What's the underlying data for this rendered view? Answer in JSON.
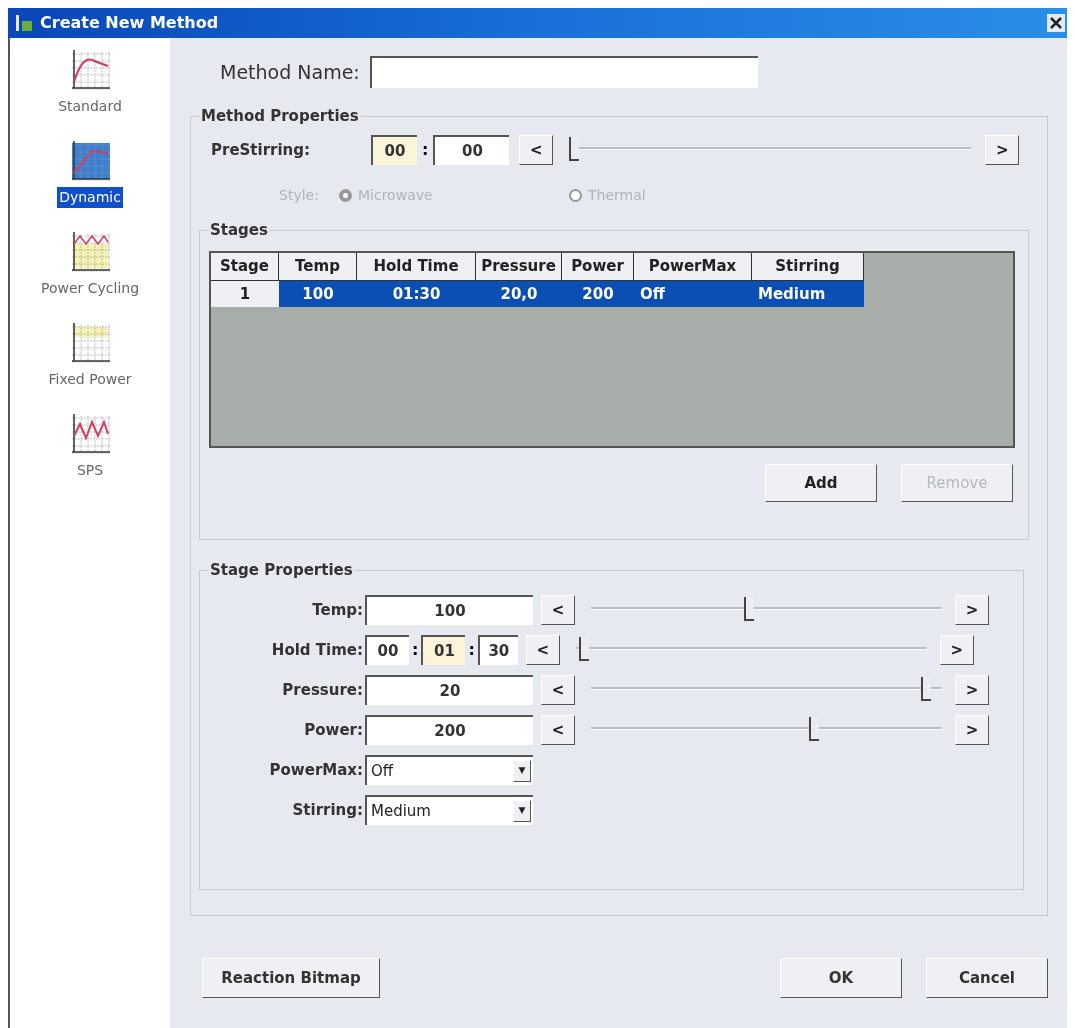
{
  "window": {
    "title": "Create New Method"
  },
  "sidebar": {
    "items": [
      {
        "label": "Standard",
        "selected": false
      },
      {
        "label": "Dynamic",
        "selected": true
      },
      {
        "label": "Power Cycling",
        "selected": false
      },
      {
        "label": "Fixed Power",
        "selected": false
      },
      {
        "label": "SPS",
        "selected": false
      }
    ]
  },
  "method_name": {
    "label": "Method Name:"
  },
  "method_properties": {
    "title": "Method Properties",
    "prestirring": {
      "label": "PreStirring:",
      "fields": [
        {
          "value": "00",
          "focused": true
        },
        {
          "value": "00",
          "focused": false
        }
      ],
      "separator": ":",
      "decrement": "<",
      "increment": ">",
      "level": 0.0
    },
    "style": {
      "label": "Style:",
      "disabled": true,
      "options": [
        {
          "label": "Microwave",
          "selected": true
        },
        {
          "label": "Thermal",
          "selected": false
        }
      ]
    }
  },
  "stages": {
    "title": "Stages",
    "columns": [
      "Stage",
      "Temp",
      "Hold Time",
      "Pressure",
      "Power",
      "PowerMax",
      "Stirring"
    ],
    "rows": [
      {
        "cells": [
          "1",
          "100",
          "01:30",
          "20,0",
          "200",
          "Off",
          "Medium"
        ],
        "selected": true
      }
    ],
    "buttons": [
      {
        "label": "Add",
        "disabled": false
      },
      {
        "label": "Remove",
        "disabled": true
      }
    ]
  },
  "stage_properties": {
    "title": "Stage Properties",
    "rows": [
      {
        "kind": "slider",
        "label": "Temp:",
        "value": "100",
        "decrement": "<",
        "increment": ">",
        "level": 0.45
      },
      {
        "kind": "time",
        "label": "Hold Time:",
        "fields": [
          {
            "value": "00",
            "focused": false
          },
          {
            "value": "01",
            "focused": true
          },
          {
            "value": "30",
            "focused": false
          }
        ],
        "separator": ":",
        "decrement": "<",
        "increment": ">",
        "level": 0.01
      },
      {
        "kind": "slider",
        "label": "Pressure:",
        "value": "20",
        "decrement": "<",
        "increment": ">",
        "level": 0.97
      },
      {
        "kind": "slider",
        "label": "Power:",
        "value": "200",
        "decrement": "<",
        "increment": ">",
        "level": 0.64
      },
      {
        "kind": "dropdown",
        "label": "PowerMax:",
        "value": "Off",
        "arrow": "▼"
      },
      {
        "kind": "dropdown",
        "label": "Stirring:",
        "value": "Medium",
        "arrow": "▼"
      }
    ]
  },
  "footer": {
    "buttons": [
      {
        "label": "Reaction Bitmap",
        "kind": "left"
      },
      {
        "label": "OK",
        "kind": "right"
      },
      {
        "label": "Cancel",
        "kind": "right"
      }
    ]
  }
}
